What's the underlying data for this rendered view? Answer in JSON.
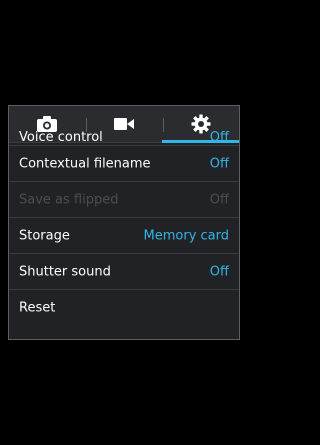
{
  "tabs": [
    {
      "name": "camera",
      "icon": "camera-icon"
    },
    {
      "name": "video",
      "icon": "video-icon"
    },
    {
      "name": "settings",
      "icon": "gear-icon",
      "active": true
    }
  ],
  "settings": [
    {
      "label": "Voice control",
      "value": "Off"
    },
    {
      "label": "Contextual filename",
      "value": "Off"
    },
    {
      "label": "Save as flipped",
      "value": "Off",
      "disabled": true
    },
    {
      "label": "Storage",
      "value": "Memory card"
    },
    {
      "label": "Shutter sound",
      "value": "Off"
    },
    {
      "label": "Reset",
      "value": ""
    }
  ],
  "colors": {
    "accent": "#33b5e5",
    "disabled": "#4c4e52",
    "panel": "#202225"
  }
}
